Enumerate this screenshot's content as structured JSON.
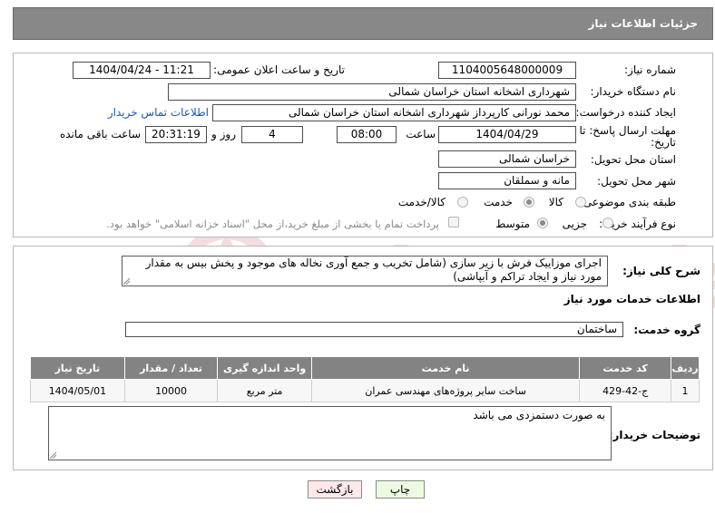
{
  "header": {
    "title": "جزئیات اطلاعات نیاز"
  },
  "form": {
    "need_number_label": "شماره نیاز:",
    "need_number": "1104005648000009",
    "announce_label": "تاریخ و ساعت اعلان عمومی:",
    "announce_value": "1404/04/24 - 11:21",
    "buyer_label": "نام دستگاه خریدار:",
    "buyer_value": "شهرداری اشخانه استان خراسان شمالی",
    "requester_label": "ایجاد کننده درخواست:",
    "requester_value": "محمد نورانی کارپرداز شهرداری اشخانه استان خراسان شمالی",
    "contact_link": "اطلاعات تماس خریدار",
    "deadline_label_1": "مهلت ارسال پاسخ: تا",
    "deadline_label_2": "تاریخ:",
    "deadline_date": "1404/04/29",
    "time_label": "ساعت",
    "deadline_time": "08:00",
    "days_value": "4",
    "days_label": "روز و",
    "remaining_time": "20:31:19",
    "remaining_label": "ساعت باقی مانده",
    "province_label": "استان محل تحویل:",
    "province_value": "خراسان شمالی",
    "city_label": "شهر محل تحویل:",
    "city_value": "مانه و سملقان",
    "category_label": "طبقه بندی موضوعی:",
    "category_options": [
      "کالا",
      "خدمت",
      "کالا/خدمت"
    ],
    "purchase_label": "نوع فرآیند خرید :",
    "purchase_options": [
      "جزیی",
      "متوسط"
    ],
    "payment_note": "پرداخت تمام یا بخشی از مبلغ خرید،از محل \"اسناد خزانه اسلامی\" خواهد بود."
  },
  "details": {
    "summary_label": "شرح کلی نیاز:",
    "summary_text": "اجرای موزاییک فرش با زیر سازی (شامل تخریب و جمع آوری نخاله های موجود و پخش بیس به مقدار مورد نیاز و ایجاد تراکم و آبپاشی)",
    "services_title": "اطلاعات خدمات مورد نیاز",
    "service_group_label": "گروه خدمت:",
    "service_group_value": "ساختمان",
    "table": {
      "headers": [
        "ردیف",
        "کد خدمت",
        "نام خدمت",
        "واحد اندازه گیری",
        "تعداد / مقدار",
        "تاریخ نیاز"
      ],
      "rows": [
        [
          "1",
          "ج-42-429",
          "ساخت سایر پروژه‌های مهندسی عمران",
          "متر مربع",
          "10000",
          "1404/05/01"
        ]
      ]
    },
    "notes_label": "توضیحات خریدار:",
    "notes_text": "به صورت دستمزدی می باشد"
  },
  "buttons": {
    "print": "چاپ",
    "back": "بازگشت"
  },
  "colors": {
    "header_bg": "#888888",
    "table_header_bg": "#838383",
    "link": "#1a55b5",
    "back_bg": "#fde8ea",
    "print_bg": "#ecfbe0"
  }
}
